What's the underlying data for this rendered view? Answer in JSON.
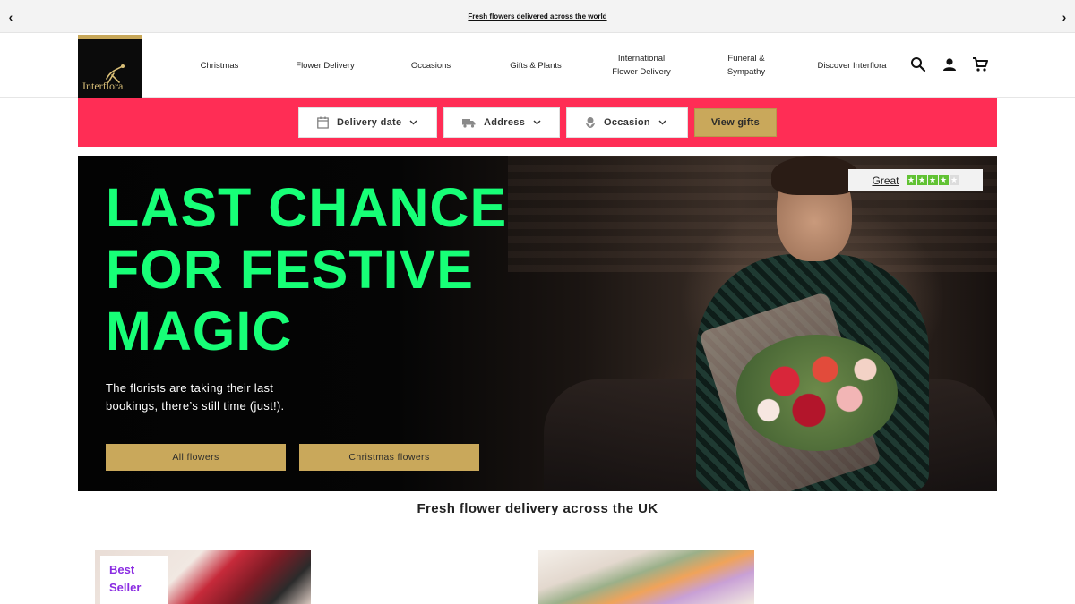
{
  "topbar": {
    "promo_text": "Fresh flowers delivered across the world",
    "prev_icon": "chevron-left-icon",
    "next_icon": "chevron-right-icon"
  },
  "header": {
    "logo_text": "Interflora",
    "nav": [
      {
        "line1": "Christmas",
        "line2": ""
      },
      {
        "line1": "Flower Delivery",
        "line2": ""
      },
      {
        "line1": "Occasions",
        "line2": ""
      },
      {
        "line1": "Gifts & Plants",
        "line2": ""
      },
      {
        "line1": "International",
        "line2": "Flower Delivery"
      },
      {
        "line1": "Funeral &",
        "line2": "Sympathy"
      },
      {
        "line1": "Discover Interflora",
        "line2": ""
      }
    ],
    "icons": [
      "search-icon",
      "account-icon",
      "cart-icon"
    ]
  },
  "search": {
    "delivery_date": "Delivery date",
    "address": "Address",
    "occasion": "Occasion",
    "submit": "View gifts"
  },
  "hero": {
    "headline_lines": [
      "LAST CHANCE",
      "FOR FESTIVE",
      "MAGIC"
    ],
    "subtext_lines": [
      "The florists are taking their last",
      "bookings, there’s still time (just!)."
    ],
    "cta_primary": "All flowers",
    "cta_secondary": "Christmas flowers",
    "rating_label": "Great",
    "rating_stars_filled": 4,
    "rating_stars_total": 5
  },
  "section": {
    "title": "Fresh flower delivery across the UK"
  },
  "products": [
    {
      "badge_line1": "Best",
      "badge_line2": "Seller"
    },
    {
      "badge_line1": "",
      "badge_line2": ""
    }
  ],
  "colors": {
    "brand_gold": "#c9a85b",
    "search_strip": "#ff2d55",
    "headline_green": "#17ff77",
    "badge_purple": "#8a2be2"
  }
}
